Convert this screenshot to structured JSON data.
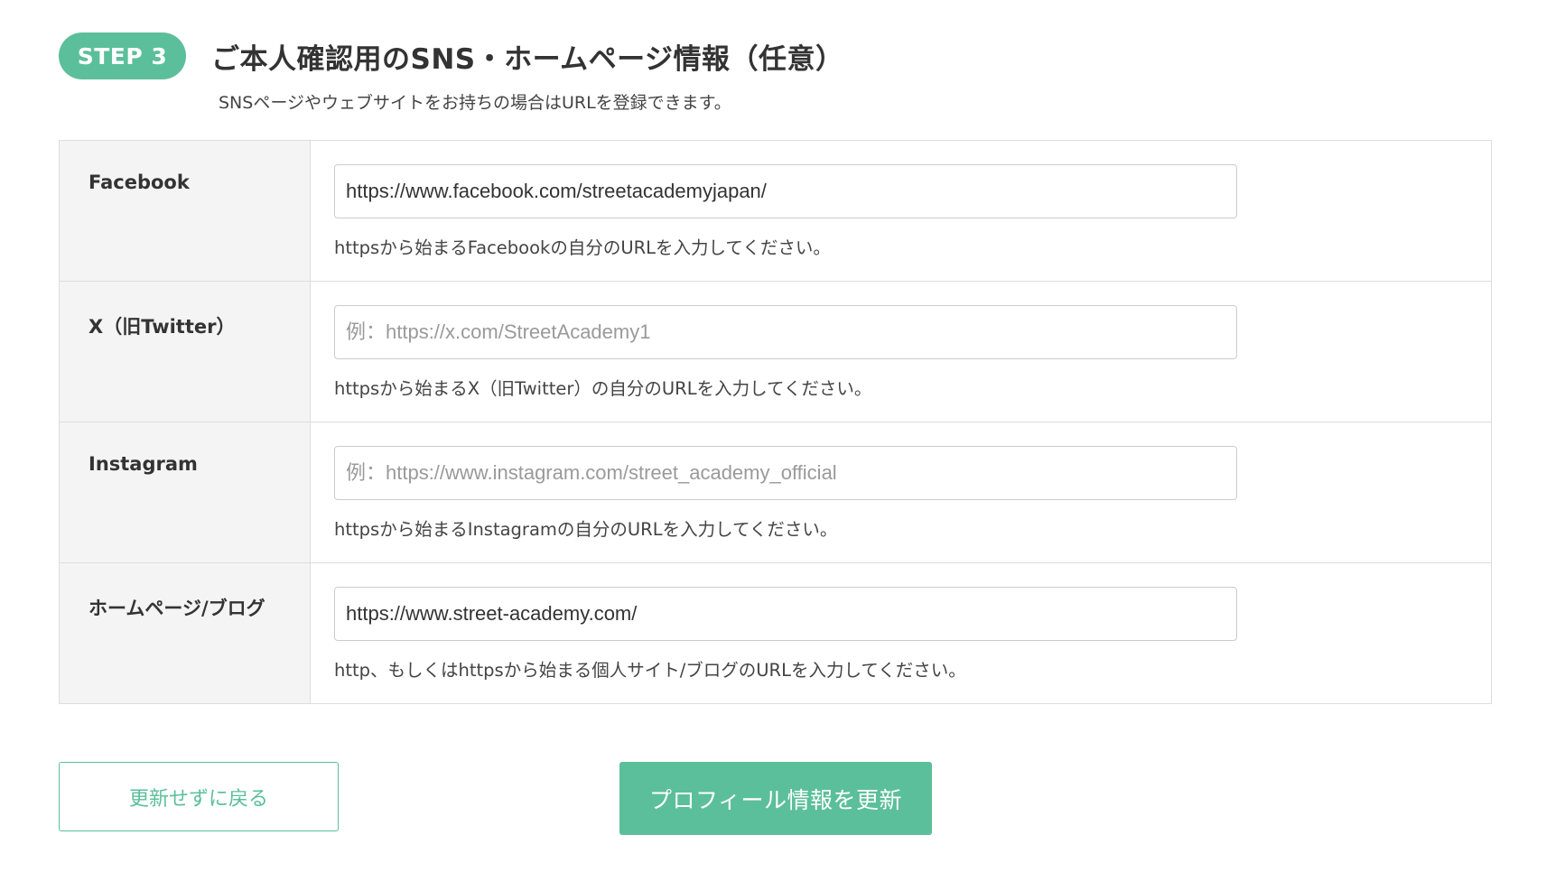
{
  "step": {
    "badge": "STEP 3",
    "title": "ご本人確認用のSNS・ホームページ情報（任意）",
    "subtitle": "SNSページやウェブサイトをお持ちの場合はURLを登録できます。"
  },
  "rows": [
    {
      "label": "Facebook",
      "value": "https://www.facebook.com/streetacademyjapan/",
      "placeholder": "",
      "help": "httpsから始まるFacebookの自分のURLを入力してください。"
    },
    {
      "label": "X（旧Twitter）",
      "value": "",
      "placeholder": "例：https://x.com/StreetAcademy1",
      "help": "httpsから始まるX（旧Twitter）の自分のURLを入力してください。"
    },
    {
      "label": "Instagram",
      "value": "",
      "placeholder": "例：https://www.instagram.com/street_academy_official",
      "help": "httpsから始まるInstagramの自分のURLを入力してください。"
    },
    {
      "label": "ホームページ/ブログ",
      "value": "https://www.street-academy.com/",
      "placeholder": "",
      "help": "http、もしくはhttpsから始まる個人サイト/ブログのURLを入力してください。"
    }
  ],
  "buttons": {
    "back": "更新せずに戻る",
    "submit": "プロフィール情報を更新"
  },
  "colors": {
    "accent": "#5bbf9b",
    "label_bg": "#f4f4f4",
    "border": "#dddddd"
  }
}
